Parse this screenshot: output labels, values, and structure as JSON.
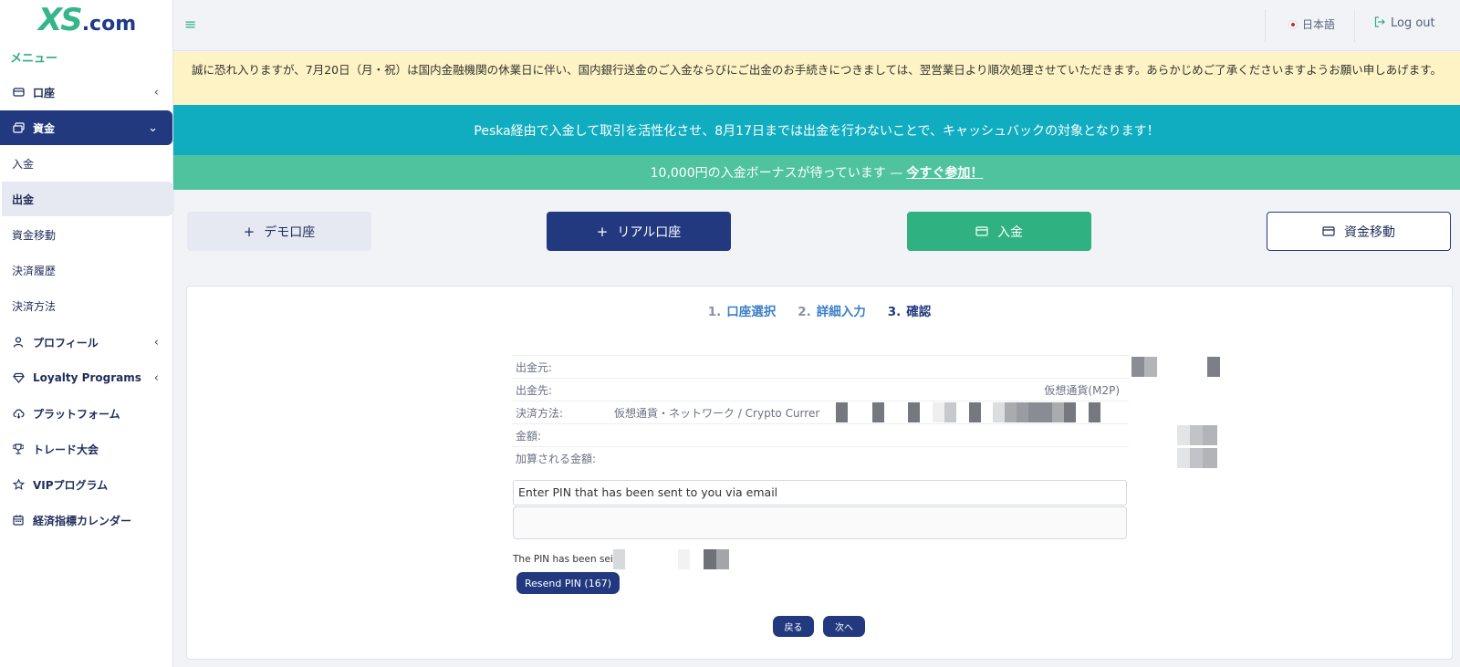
{
  "brand": {
    "logo_xs": "XS",
    "logo_com": ".com"
  },
  "sidebar": {
    "heading": "メニュー",
    "items": [
      {
        "label": "口座",
        "icon": "wallet-icon"
      },
      {
        "label": "資金",
        "icon": "money-stack-icon"
      },
      {
        "label": "プロフィール",
        "icon": "user-icon"
      },
      {
        "label": "Loyalty Programs",
        "icon": "diamond-icon"
      },
      {
        "label": "プラットフォーム",
        "icon": "cloud-download-icon"
      },
      {
        "label": "トレード大会",
        "icon": "trophy-icon"
      },
      {
        "label": "VIPプログラム",
        "icon": "star-icon"
      },
      {
        "label": "経済指標カレンダー",
        "icon": "calendar-icon"
      }
    ],
    "sub_items": [
      "入金",
      "出金",
      "資金移動",
      "決済履歴",
      "決済方法"
    ]
  },
  "header": {
    "language": "日本語",
    "logout": "Log out"
  },
  "notice": "誠に恐れ入りますが、7月20日（月・祝）は国内金融機関の休業日に伴い、国内銀行送金のご入金ならびにご出金のお手続きにつきましては、翌営業日より順次処理させていただきます。あらかじめご了承くださいますようお願い申しあげます。",
  "promo1": "Peska経由で入金して取引を活性化させ、8月17日までは出金を行わないことで、キャッシュバックの対象となります！",
  "promo2": {
    "text": "10,000円の入金ボーナスが待っています —",
    "link": "今すぐ参加！"
  },
  "actions": {
    "demo": "デモ口座",
    "real": "リアル口座",
    "deposit": "入金",
    "transfer": "資金移動"
  },
  "steps": [
    {
      "num": "1.",
      "label": "口座選択"
    },
    {
      "num": "2.",
      "label": "詳細入力"
    },
    {
      "num": "3.",
      "label": "確認"
    }
  ],
  "summary": {
    "from_label": "出金元:",
    "to_label": "出金先:",
    "to_value": "仮想通貨(M2P)",
    "method_label": "決済方法:",
    "method_value": "仮想通貨・ネットワーク / Crypto Currer",
    "amount_label": "金額:",
    "credited_label": "加算される金額:"
  },
  "pin": {
    "prompt": "Enter PIN that has been sent to you via email",
    "sent_text": "The PIN has been sei",
    "resend": "Resend PIN (167)"
  },
  "nav": {
    "back": "戻る",
    "next": "次へ"
  },
  "colors": {
    "brand_navy": "#22397f",
    "brand_green": "#2fb182",
    "teal": "#10adc1",
    "notice_bg": "#fdf3c4"
  }
}
